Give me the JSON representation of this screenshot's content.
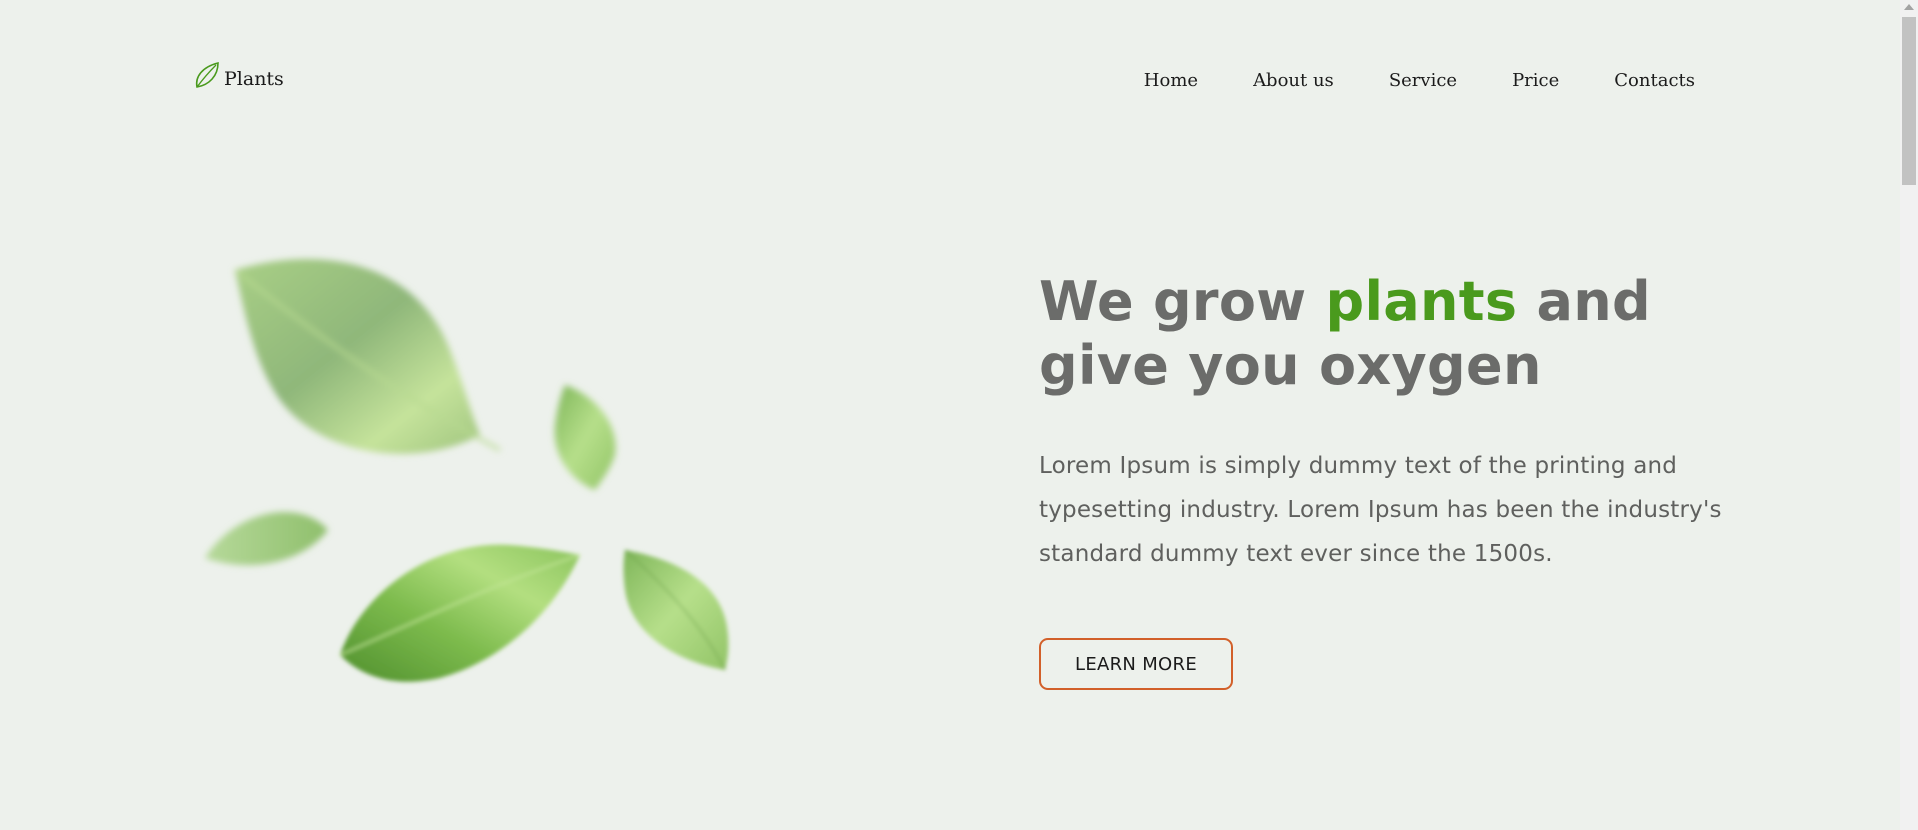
{
  "header": {
    "logo_text": "Plants",
    "logo_icon": "leaf-icon",
    "nav": [
      {
        "label": "Home"
      },
      {
        "label": "About us"
      },
      {
        "label": "Service"
      },
      {
        "label": "Price"
      },
      {
        "label": "Contacts"
      }
    ]
  },
  "hero": {
    "title_before": "We grow ",
    "title_accent": "plants",
    "title_after": " and give you oxygen",
    "description": "Lorem Ipsum is simply dummy text of the printing and typesetting industry. Lorem Ipsum has been the industry's standard dummy text ever since the 1500s.",
    "button_label": "LEARN MORE",
    "image": "falling-leaves-illustration"
  },
  "colors": {
    "background": "#edf1ec",
    "accent_green": "#4a9a1d",
    "title_gray": "#6b6c6a",
    "button_border": "#d2602a"
  }
}
